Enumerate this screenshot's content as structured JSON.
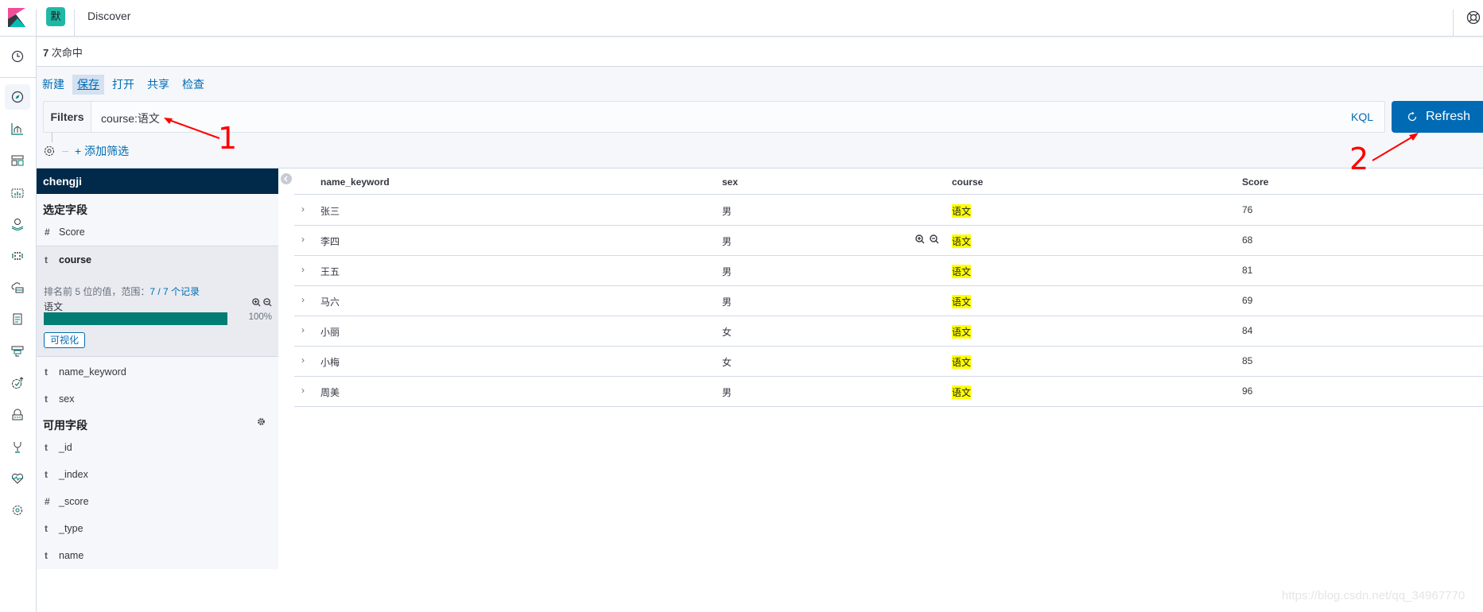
{
  "header": {
    "space_initial": "默",
    "app_title": "Discover"
  },
  "nav": {
    "items": [
      {
        "name": "recently-viewed-icon"
      },
      {
        "name": "discover-icon",
        "active": true
      },
      {
        "name": "visualize-icon"
      },
      {
        "name": "dashboard-icon"
      },
      {
        "name": "canvas-icon"
      },
      {
        "name": "maps-icon"
      },
      {
        "name": "ml-icon"
      },
      {
        "name": "infrastructure-icon"
      },
      {
        "name": "logs-icon"
      },
      {
        "name": "apm-icon"
      },
      {
        "name": "uptime-icon"
      },
      {
        "name": "siem-icon"
      },
      {
        "name": "dev-tools-icon"
      },
      {
        "name": "monitoring-icon"
      },
      {
        "name": "management-icon"
      }
    ]
  },
  "hits": {
    "count": "7",
    "label": " 次命中"
  },
  "menu": {
    "items": [
      {
        "label": "新建",
        "active": false
      },
      {
        "label": "保存",
        "active": true
      },
      {
        "label": "打开",
        "active": false
      },
      {
        "label": "共享",
        "active": false
      },
      {
        "label": "检查",
        "active": false
      }
    ]
  },
  "query_bar": {
    "filters_label": "Filters",
    "query": "course:语文",
    "language": "KQL",
    "refresh_label": "Refresh",
    "add_filter": "+ 添加筛选"
  },
  "sidebar": {
    "index_pattern": "chengji",
    "selected_title": "选定字段",
    "selected_fields": [
      {
        "type": "#",
        "name": "Score"
      },
      {
        "type": "t",
        "name": "course",
        "expanded": true
      },
      {
        "type": "t",
        "name": "name_keyword"
      },
      {
        "type": "t",
        "name": "sex"
      }
    ],
    "details": {
      "summary_prefix": "排名前 5 位的值，范围：",
      "summary_count": "7 / 7 个记录",
      "bucket_value": "语文",
      "bucket_percent": 100,
      "bucket_percent_label": "100%",
      "visualize_label": "可视化"
    },
    "available_title": "可用字段",
    "available_fields": [
      {
        "type": "t",
        "name": "_id"
      },
      {
        "type": "t",
        "name": "_index"
      },
      {
        "type": "#",
        "name": "_score"
      },
      {
        "type": "t",
        "name": "_type"
      },
      {
        "type": "t",
        "name": "name"
      }
    ]
  },
  "table": {
    "columns": [
      "name_keyword",
      "sex",
      "course",
      "Score"
    ],
    "rows": [
      {
        "name_keyword": "张三",
        "sex": "男",
        "course": "语文",
        "score": "76"
      },
      {
        "name_keyword": "李四",
        "sex": "男",
        "course": "语文",
        "score": "68"
      },
      {
        "name_keyword": "王五",
        "sex": "男",
        "course": "语文",
        "score": "81"
      },
      {
        "name_keyword": "马六",
        "sex": "男",
        "course": "语文",
        "score": "69"
      },
      {
        "name_keyword": "小丽",
        "sex": "女",
        "course": "语文",
        "score": "84"
      },
      {
        "name_keyword": "小梅",
        "sex": "女",
        "course": "语文",
        "score": "85"
      },
      {
        "name_keyword": "周美",
        "sex": "男",
        "course": "语文",
        "score": "96"
      }
    ]
  },
  "annotations": {
    "one": "1",
    "two": "2",
    "color": "#ff0000"
  },
  "watermark": "https://blog.csdn.net/qq_34967770",
  "colors": {
    "primary": "#006bb4",
    "index_bar": "#00294a",
    "bucket_fill": "#017d73",
    "highlight": "#ffff00"
  }
}
